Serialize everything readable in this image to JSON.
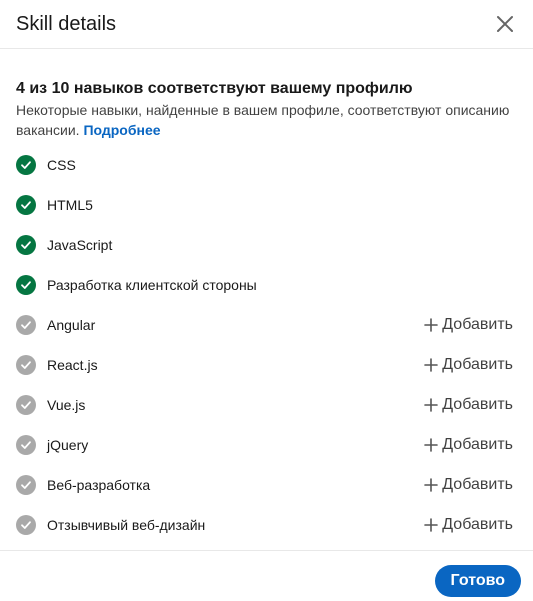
{
  "dialog": {
    "title": "Skill details",
    "close_icon": "close-icon"
  },
  "summary": {
    "heading": "4 из 10 навыков соответствуют вашему профилю",
    "description": "Некоторые навыки, найденные в вашем профиле, соответствуют описанию вакансии.",
    "learn_more": "Подробнее"
  },
  "skills": [
    {
      "name": "CSS",
      "matched": true
    },
    {
      "name": "HTML5",
      "matched": true
    },
    {
      "name": "JavaScript",
      "matched": true
    },
    {
      "name": "Разработка клиентской стороны",
      "matched": true
    },
    {
      "name": "Angular",
      "matched": false,
      "action": "Добавить"
    },
    {
      "name": "React.js",
      "matched": false,
      "action": "Добавить"
    },
    {
      "name": "Vue.js",
      "matched": false,
      "action": "Добавить"
    },
    {
      "name": "jQuery",
      "matched": false,
      "action": "Добавить"
    },
    {
      "name": "Веб-разработка",
      "matched": false,
      "action": "Добавить"
    },
    {
      "name": "Отзывчивый веб-дизайн",
      "matched": false,
      "action": "Добавить"
    }
  ],
  "footer": {
    "done_label": "Готово"
  },
  "colors": {
    "matched": "#057642",
    "unmatched": "#a9a9a9",
    "primary": "#0a66c2"
  }
}
